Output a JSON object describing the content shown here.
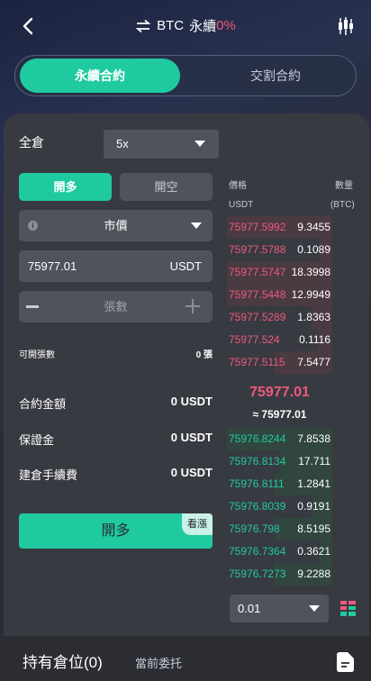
{
  "header": {
    "symbol": "BTC",
    "contract_type": "永續",
    "change_pct": "0%"
  },
  "modes": {
    "active": "永續合約",
    "inactive": "交割合約"
  },
  "form": {
    "margin_mode": "全倉",
    "leverage": "5x",
    "side_long": "開多",
    "side_short": "開空",
    "order_type": "市價",
    "price_value": "75977.01",
    "price_unit": "USDT",
    "quantity_placeholder": "張數",
    "available_label": "可開張數",
    "available_value": "0 張",
    "contract_amount_label": "合約金額",
    "contract_amount_value": "0 USDT",
    "margin_label": "保證金",
    "margin_value": "0 USDT",
    "fee_label": "建倉手續費",
    "fee_value": "0 USDT",
    "submit_label": "開多",
    "submit_tag": "看漲"
  },
  "orderbook": {
    "price_header": "價格",
    "price_unit": "USDT",
    "amount_header": "數量",
    "amount_unit": "(BTC)",
    "asks": [
      {
        "price": "75977.5992",
        "amount": "9.3455",
        "depth": 1.0
      },
      {
        "price": "75977.5788",
        "amount": "0.1089",
        "depth": 0.12
      },
      {
        "price": "75977.5747",
        "amount": "18.3998",
        "depth": 1.0
      },
      {
        "price": "75977.5448",
        "amount": "12.9949",
        "depth": 1.0
      },
      {
        "price": "75977.5289",
        "amount": "1.8363",
        "depth": 0.2
      },
      {
        "price": "75977.524",
        "amount": "0.1116",
        "depth": 0.14
      },
      {
        "price": "75977.5115",
        "amount": "7.5477",
        "depth": 0.55
      }
    ],
    "last_price": "75977.01",
    "last_price_ref": "≈ 75977.01",
    "bids": [
      {
        "price": "75976.8244",
        "amount": "7.8538",
        "depth": 1.0
      },
      {
        "price": "75976.8134",
        "amount": "17.711",
        "depth": 0.5
      },
      {
        "price": "75976.8111",
        "amount": "1.2841",
        "depth": 0.55
      },
      {
        "price": "75976.8039",
        "amount": "0.9191",
        "depth": 0.2
      },
      {
        "price": "75976.798",
        "amount": "8.5195",
        "depth": 0.55
      },
      {
        "price": "75976.7364",
        "amount": "0.3621",
        "depth": 0.12
      },
      {
        "price": "75976.7273",
        "amount": "9.2288",
        "depth": 0.55
      }
    ],
    "depth_step": "0.01"
  },
  "bottom": {
    "positions_label": "持有倉位(0)",
    "current_orders_label": "當前委托"
  },
  "colors": {
    "accent": "#1fcaa0",
    "sell": "#ee5a7d",
    "panel": "#383a41",
    "control": "#50535c"
  }
}
